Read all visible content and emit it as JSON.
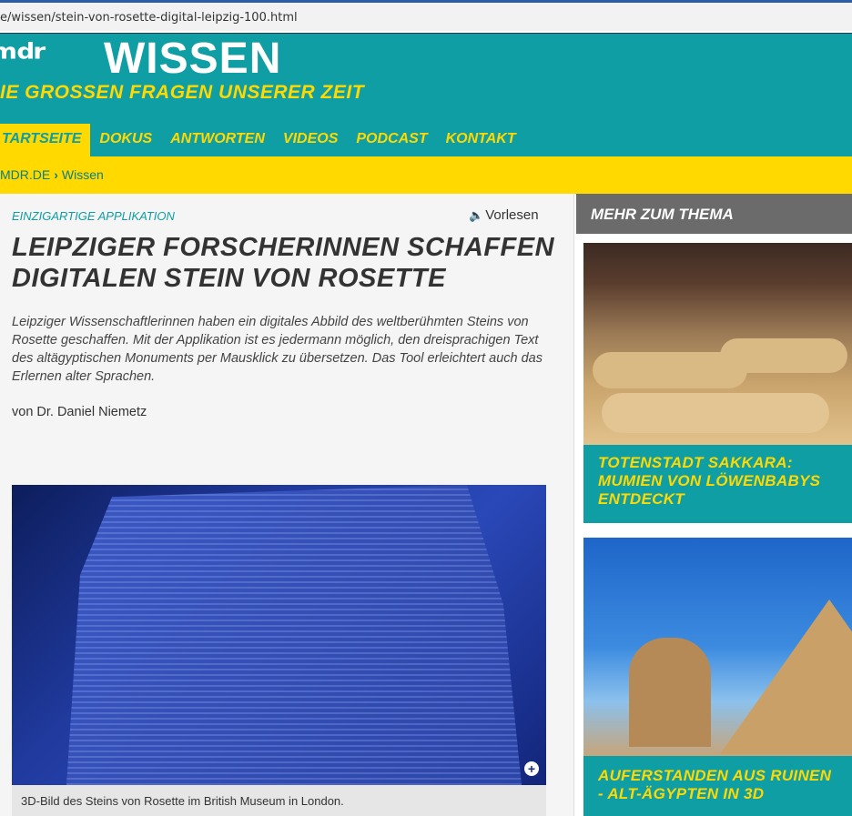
{
  "browser": {
    "url": "e/wissen/stein-von-rosette-digital-leipzig-100.html"
  },
  "header": {
    "logo_mdr": "ᵐᵈʳ",
    "logo_wissen": "WISSEN",
    "tagline": "IE GROSSEN FRAGEN UNSERER ZEIT",
    "nav": [
      "TARTSEITE",
      "DOKUS",
      "ANTWORTEN",
      "VIDEOS",
      "PODCAST",
      "KONTAKT"
    ]
  },
  "breadcrumb": {
    "items": [
      "MDR.DE",
      "Wissen"
    ],
    "separator": "›"
  },
  "article": {
    "kicker": "EINZIGARTIGE APPLIKATION",
    "vorlesen": "Vorlesen",
    "headline": "LEIPZIGER FORSCHERINNEN SCHAFFEN DIGITALEN STEIN VON ROSETTE",
    "teaser": "Leipziger Wissenschaftlerinnen haben ein digitales Abbild des weltberühmten Steins von Rosette geschaffen. Mit der Applikation ist es jedermann möglich, den dreisprachigen Text des altägyptischen Monuments per Mausklick zu übersetzen. Das Tool erleichtert auch das Erlernen alter Sprachen.",
    "author": "von Dr. Daniel Niemetz",
    "image_caption": "3D-Bild des Steins von Rosette im British Museum in London."
  },
  "sidebar": {
    "heading": "MEHR ZUM THEMA",
    "cards": [
      {
        "title": "TOTENSTADT SAKKARA: MUMIEN VON LÖWENBABYS ENTDECKT"
      },
      {
        "title": "AUFERSTANDEN AUS RUINEN - ALT-ÄGYPTEN IN 3D"
      }
    ]
  },
  "colors": {
    "teal": "#0f9ea3",
    "yellow": "#ffd900",
    "gray_header": "#6b6b6b"
  }
}
